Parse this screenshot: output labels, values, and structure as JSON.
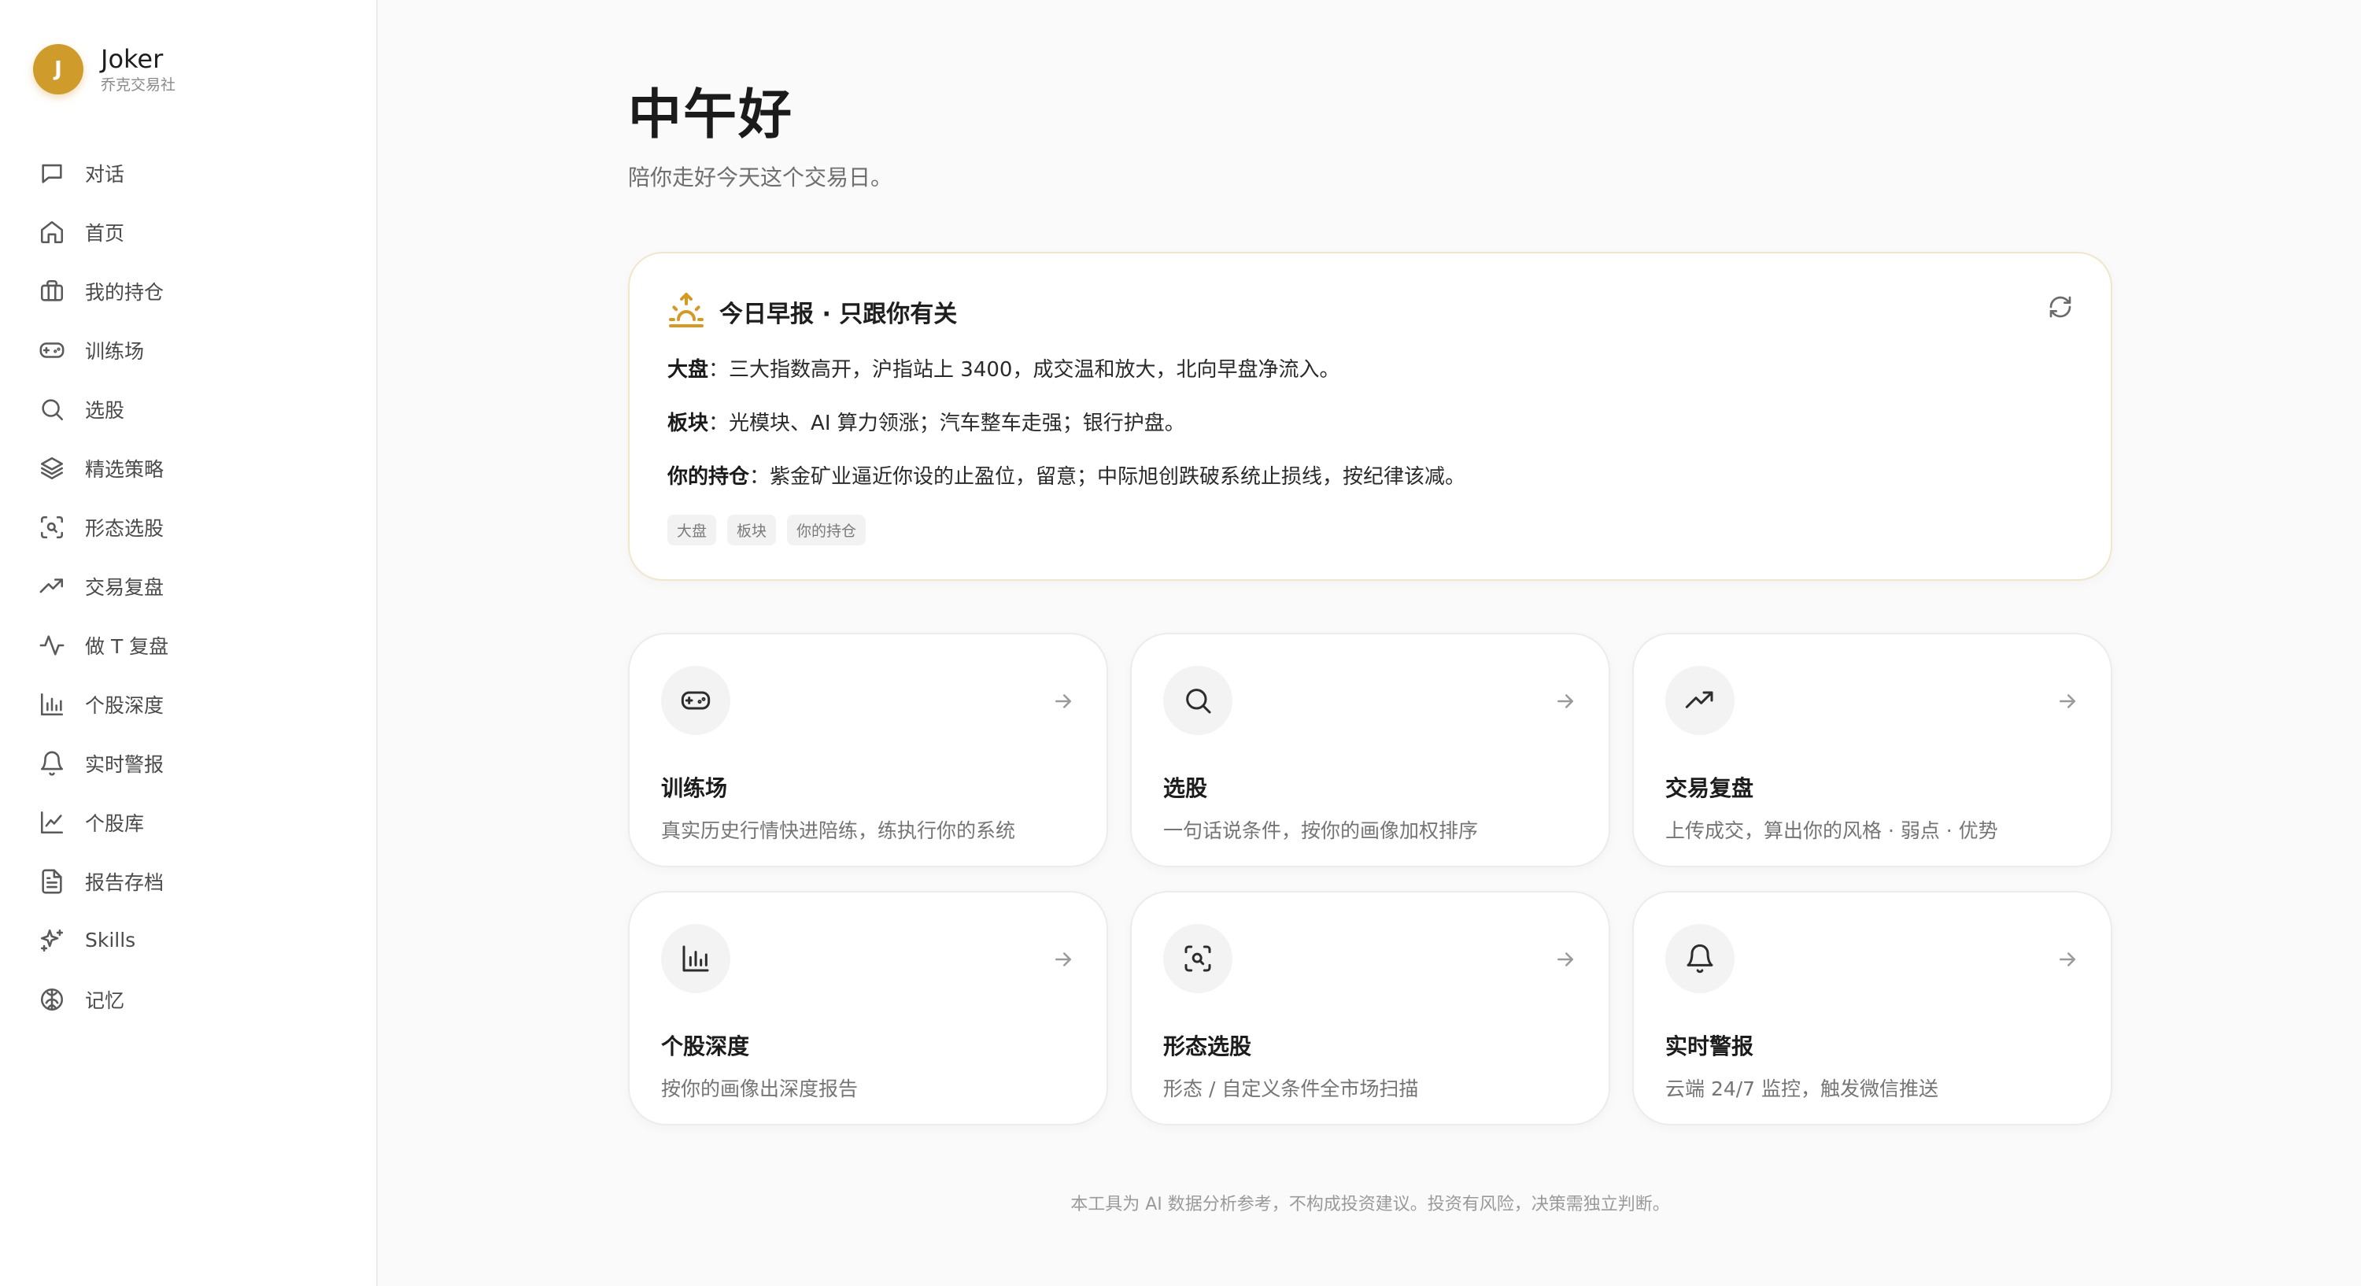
{
  "brand": {
    "initial": "J",
    "name": "Joker",
    "subtitle": "乔克交易社",
    "accent": "#cf9b2a"
  },
  "sidebar": {
    "items": [
      {
        "label": "对话",
        "icon": "chat-icon"
      },
      {
        "label": "首页",
        "icon": "home-icon"
      },
      {
        "label": "我的持仓",
        "icon": "briefcase-icon"
      },
      {
        "label": "训练场",
        "icon": "gamepad-icon"
      },
      {
        "label": "选股",
        "icon": "search-icon"
      },
      {
        "label": "精选策略",
        "icon": "layers-icon"
      },
      {
        "label": "形态选股",
        "icon": "scan-search-icon"
      },
      {
        "label": "交易复盘",
        "icon": "trending-up-icon"
      },
      {
        "label": "做 T 复盘",
        "icon": "activity-icon"
      },
      {
        "label": "个股深度",
        "icon": "bar-chart-icon"
      },
      {
        "label": "实时警报",
        "icon": "bell-icon"
      },
      {
        "label": "个股库",
        "icon": "line-chart-icon"
      },
      {
        "label": "报告存档",
        "icon": "file-text-icon"
      },
      {
        "label": "Skills",
        "icon": "sparkles-icon"
      },
      {
        "label": "记忆",
        "icon": "brain-icon"
      }
    ]
  },
  "main": {
    "greeting": "中午好",
    "subtitle": "陪你走好今天这个交易日。",
    "brief": {
      "title": "今日早报 · 只跟你有关",
      "lines": [
        {
          "label": "大盘",
          "sep": "：",
          "text": "三大指数高开，沪指站上 3400，成交温和放大，北向早盘净流入。"
        },
        {
          "label": "板块",
          "sep": "：",
          "text": "光模块、AI 算力领涨；汽车整车走强；银行护盘。"
        },
        {
          "label": "你的持仓",
          "sep": "：",
          "text": "紫金矿业逼近你设的止盈位，留意；中际旭创跌破系统止损线，按纪律该减。"
        }
      ],
      "tags": [
        "大盘",
        "板块",
        "你的持仓"
      ]
    },
    "cards": [
      {
        "title": "训练场",
        "desc": "真实历史行情快进陪练，练执行你的系统",
        "icon": "gamepad-icon"
      },
      {
        "title": "选股",
        "desc": "一句话说条件，按你的画像加权排序",
        "icon": "search-icon"
      },
      {
        "title": "交易复盘",
        "desc": "上传成交，算出你的风格 · 弱点 · 优势",
        "icon": "trending-up-icon"
      },
      {
        "title": "个股深度",
        "desc": "按你的画像出深度报告",
        "icon": "bar-chart-icon"
      },
      {
        "title": "形态选股",
        "desc": "形态 / 自定义条件全市场扫描",
        "icon": "scan-search-icon"
      },
      {
        "title": "实时警报",
        "desc": "云端 24/7 监控，触发微信推送",
        "icon": "bell-icon"
      }
    ],
    "footer": "本工具为 AI 数据分析参考，不构成投资建议。投资有风险，决策需独立判断。"
  }
}
